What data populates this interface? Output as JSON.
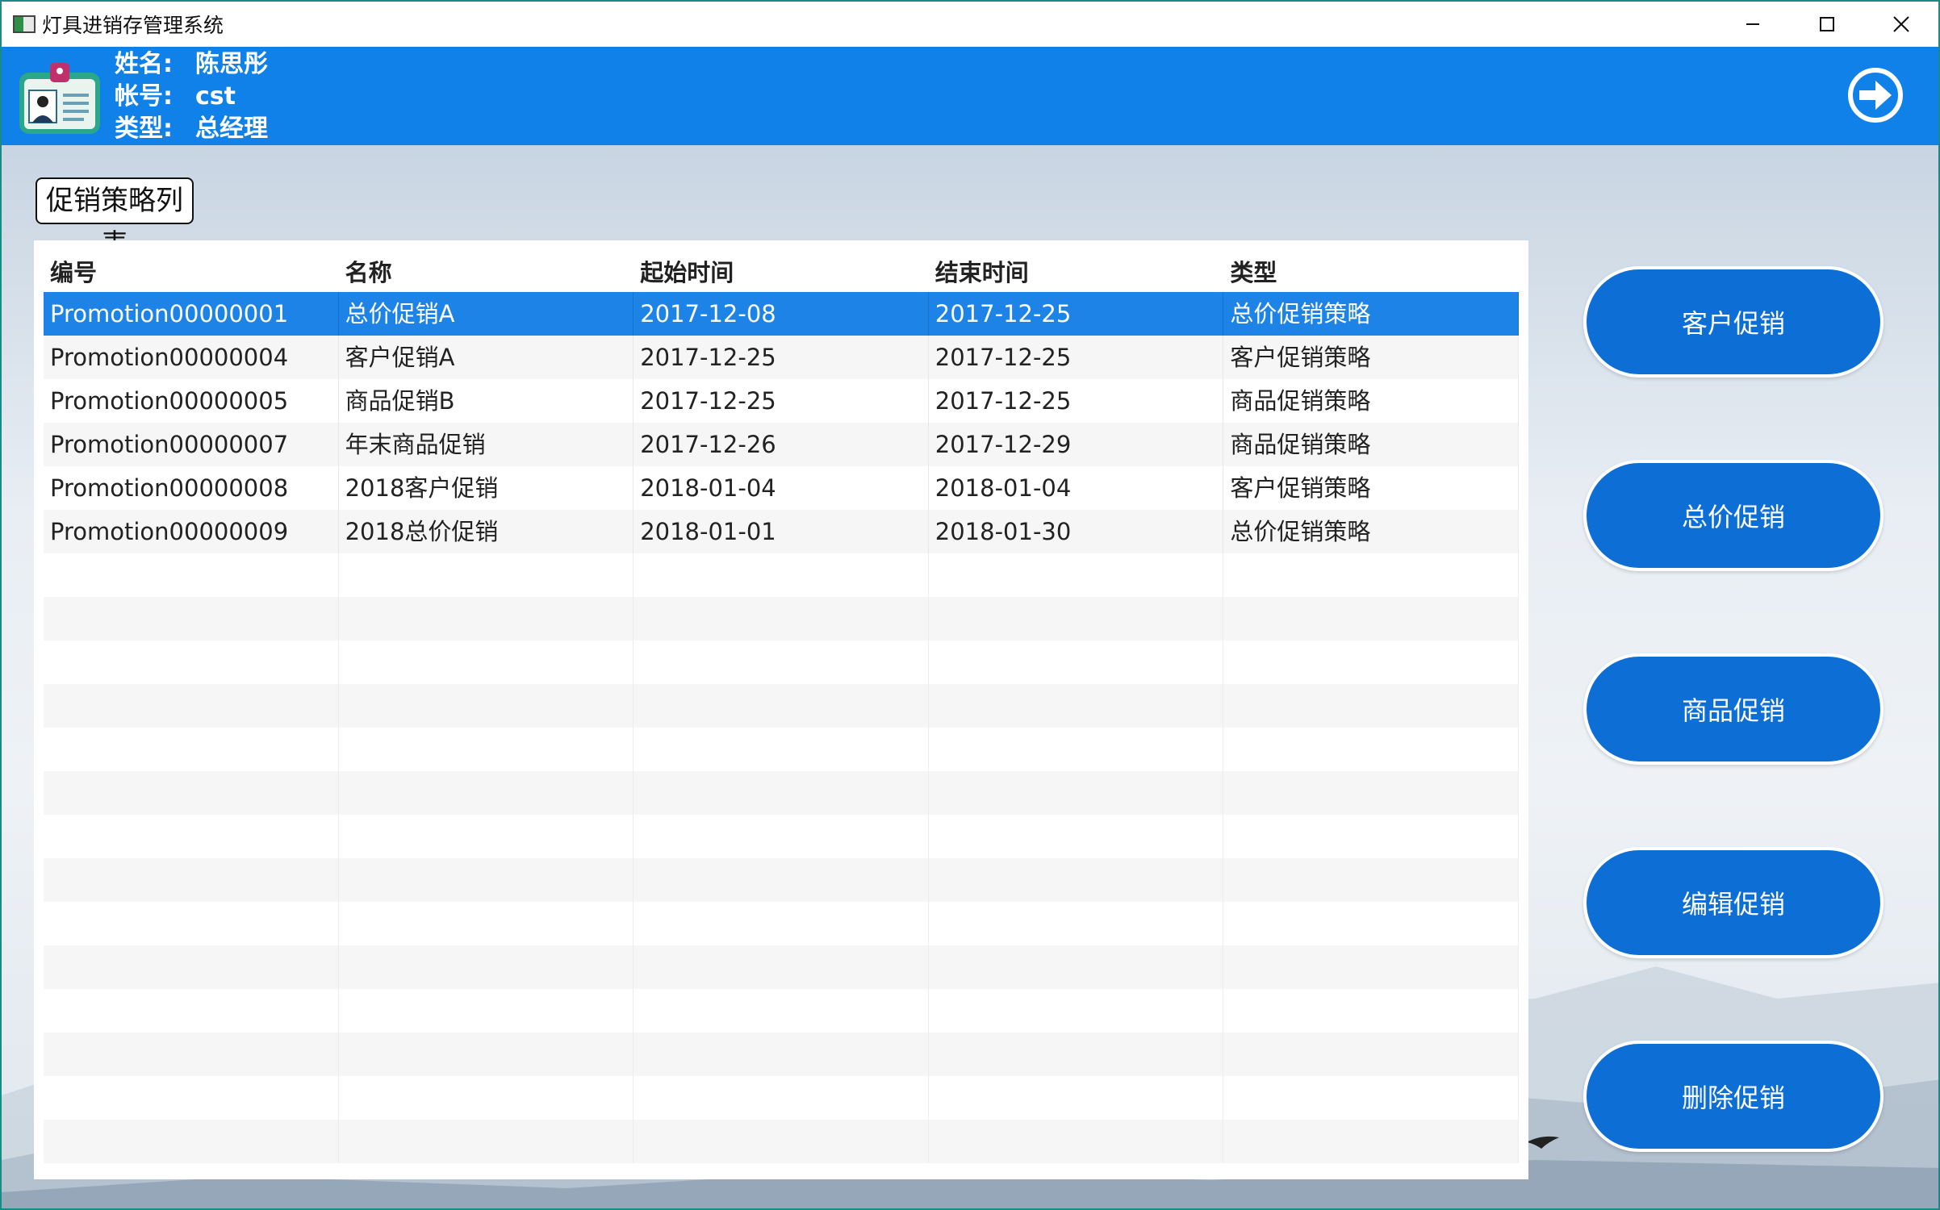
{
  "window": {
    "title": "灯具进销存管理系统"
  },
  "user": {
    "name_key": "姓名:",
    "name": "陈思彤",
    "account_key": "帐号:",
    "account": "cst",
    "type_key": "类型:",
    "type": "总经理"
  },
  "section_label": "促销策略列表",
  "table": {
    "headers": [
      "编号",
      "名称",
      "起始时间",
      "结束时间",
      "类型"
    ],
    "rows": [
      [
        "Promotion00000001",
        "总价促销A",
        "2017-12-08",
        "2017-12-25",
        "总价促销策略"
      ],
      [
        "Promotion00000004",
        "客户促销A",
        "2017-12-25",
        "2017-12-25",
        "客户促销策略"
      ],
      [
        "Promotion00000005",
        "商品促销B",
        "2017-12-25",
        "2017-12-25",
        "商品促销策略"
      ],
      [
        "Promotion00000007",
        "年末商品促销",
        "2017-12-26",
        "2017-12-29",
        "商品促销策略"
      ],
      [
        "Promotion00000008",
        "2018客户促销",
        "2018-01-04",
        "2018-01-04",
        "客户促销策略"
      ],
      [
        "Promotion00000009",
        "2018总价促销",
        "2018-01-01",
        "2018-01-30",
        "总价促销策略"
      ]
    ],
    "selected_row": 0
  },
  "actions": {
    "customer": "客户促销",
    "total": "总价促销",
    "goods": "商品促销",
    "edit": "编辑促销",
    "delete": "删除促销"
  },
  "icons": {
    "app": "app-icon",
    "badge": "id-badge-icon",
    "logout": "arrow-right-circle-icon"
  },
  "colors": {
    "accent": "#1081e8",
    "button": "#0d6fd6",
    "selected_row": "#1d83e6"
  }
}
